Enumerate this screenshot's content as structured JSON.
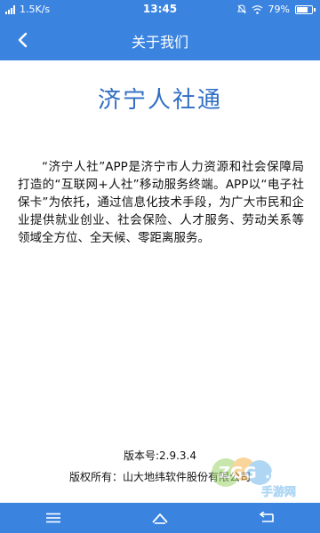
{
  "status_bar": {
    "network_speed": "1.5K/s",
    "time": "13:45",
    "battery_percent": "79%",
    "battery_level": 0.79
  },
  "app_bar": {
    "title": "关于我们"
  },
  "content": {
    "heading": "济宁人社通",
    "description": "“济宁人社”APP是济宁市人力资源和社会保障局打造的“互联网+人社”移动服务终端。APP以“电子社保卡”为依托，通过信息化技术手段，为广大市民和企业提供就业创业、社会保险、人才服务、劳动关系等领域全方位、全天候、零距离服务。"
  },
  "footer": {
    "version": "版本号:2.9.3.4",
    "copyright": "版权所有：山大地纬软件股份有限公司"
  },
  "watermark": {
    "logo_text": "ZGG.com",
    "sub_text": "手游网"
  },
  "colors": {
    "primary": "#3a84e0",
    "heading": "#2f6ec4"
  }
}
